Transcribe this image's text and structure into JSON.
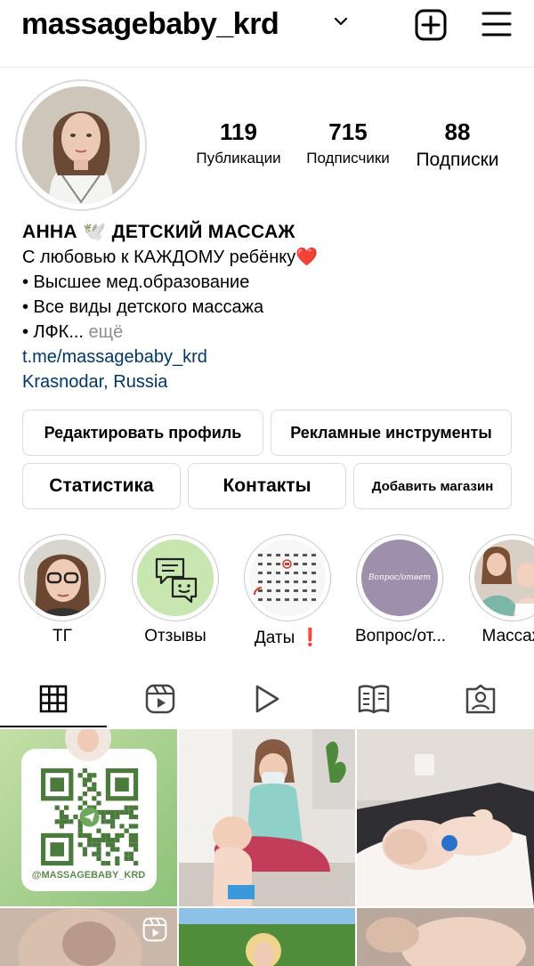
{
  "header": {
    "username": "massagebaby_krd",
    "icons": [
      "chevron-down-icon",
      "new-post-icon",
      "menu-icon"
    ]
  },
  "profile": {
    "stats": [
      {
        "value": "119",
        "label": "Публикации"
      },
      {
        "value": "715",
        "label": "Подписчики"
      },
      {
        "value": "88",
        "label": "Подписки"
      }
    ],
    "name": "АННА",
    "name_emoji": "🕊️",
    "name_suffix": "ДЕТСКИЙ МАССАЖ",
    "bio_lines": [
      "С любовью к КАЖДОМУ ребёнку",
      "• Высшее мед.образование",
      "• Все виды детского массажа",
      "• ЛФК..."
    ],
    "heart": "❤️",
    "more": "ещё",
    "link": "t.me/massagebaby_krd",
    "location": "Krasnodar, Russia"
  },
  "buttons": {
    "edit_profile": "Редактировать профиль",
    "ad_tools": "Рекламные инструменты",
    "stats": "Статистика",
    "contacts": "Контакты",
    "add_shop": "Добавить магазин"
  },
  "highlights": [
    {
      "label": "ТГ"
    },
    {
      "label": "Отзывы"
    },
    {
      "label": "Даты ❗"
    },
    {
      "label": "Вопрос/от...",
      "cover_text": "Вопрос/ответ"
    },
    {
      "label": "Массаж"
    }
  ],
  "tabs": [
    "grid-icon",
    "reels-icon",
    "video-icon",
    "guide-icon",
    "tagged-icon"
  ],
  "grid": {
    "qr_handle": "@MASSAGEBABY_KRD"
  },
  "colors": {
    "link": "#00376b",
    "muted": "#8e8e8e",
    "border": "#dbdbdb",
    "highlight_green": "#c8e6b0",
    "highlight_purple": "#9e8fad"
  }
}
